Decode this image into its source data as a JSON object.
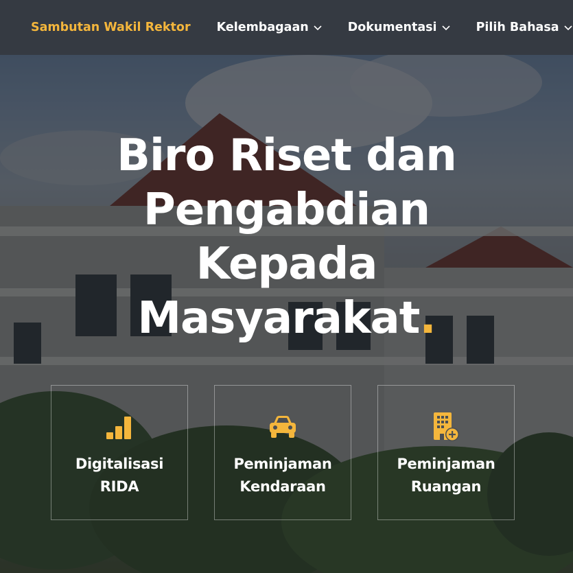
{
  "nav": {
    "items": [
      {
        "label": "Sambutan Wakil Rektor",
        "active": true,
        "dropdown": false
      },
      {
        "label": "Kelembagaan",
        "active": false,
        "dropdown": true
      },
      {
        "label": "Dokumentasi",
        "active": false,
        "dropdown": true
      },
      {
        "label": "Pilih Bahasa",
        "active": false,
        "dropdown": true
      }
    ]
  },
  "hero": {
    "title_lines": [
      "Biro Riset dan",
      "Pengabdian",
      "Kepada",
      "Masyarakat"
    ],
    "title_dot": "."
  },
  "cards": [
    {
      "icon": "bar-chart-icon",
      "line1": "Digitalisasi",
      "line2": "RIDA"
    },
    {
      "icon": "car-icon",
      "line1": "Peminjaman",
      "line2": "Kendaraan"
    },
    {
      "icon": "building-add-icon",
      "line1": "Peminjaman",
      "line2": "Ruangan"
    }
  ],
  "colors": {
    "accent": "#f4b63c",
    "nav_bg": "#353a42",
    "text": "#ffffff"
  }
}
